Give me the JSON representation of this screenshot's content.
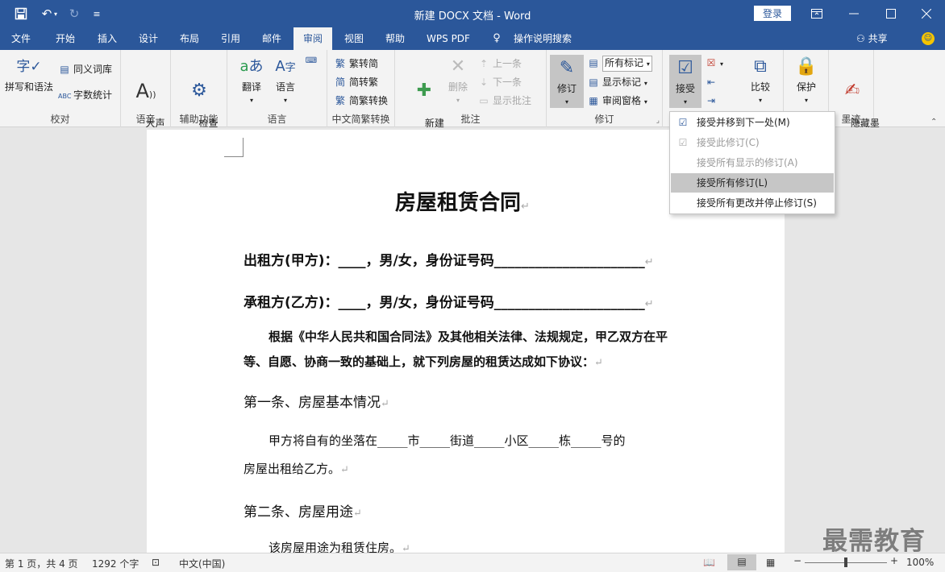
{
  "titlebar": {
    "save_icon": "save-icon",
    "undo_icon": "undo-icon",
    "redo_icon": "redo-icon",
    "customize_icon": "customize-quick-access-icon",
    "title": "新建 DOCX 文档 - Word",
    "login": "登录",
    "restore_icon": "ribbon-display-icon",
    "minimize_icon": "minimize-icon",
    "maximize_icon": "maximize-icon",
    "close_icon": "close-icon"
  },
  "tabs": [
    {
      "label": "文件"
    },
    {
      "label": "开始"
    },
    {
      "label": "插入"
    },
    {
      "label": "设计"
    },
    {
      "label": "布局"
    },
    {
      "label": "引用"
    },
    {
      "label": "邮件"
    },
    {
      "label": "审阅"
    },
    {
      "label": "视图"
    },
    {
      "label": "帮助"
    },
    {
      "label": "WPS PDF"
    },
    {
      "label": "操作说明搜索"
    }
  ],
  "share": "共享",
  "ribbon": {
    "proof": {
      "label": "校对",
      "spell": "拼写和语法",
      "thesaurus": "同义词库",
      "wordcount": "字数统计"
    },
    "speech": {
      "label": "语音",
      "read": "大声\n朗读"
    },
    "access": {
      "label": "辅助功能",
      "check": "检查\n辅助功能"
    },
    "lang": {
      "label": "语言",
      "translate": "翻译",
      "language": "语言"
    },
    "chinese": {
      "label": "中文简繁转换",
      "t2s": "繁转简",
      "s2t": "简转繁",
      "conv": "简繁转换"
    },
    "comments": {
      "label": "批注",
      "new": "新建\n批注",
      "delete": "删除",
      "prev": "上一条",
      "next": "下一条",
      "show": "显示批注"
    },
    "tracking": {
      "label": "修订",
      "track": "修订",
      "markup_select": "所有标记",
      "show_markup": "显示标记",
      "pane": "审阅窗格"
    },
    "changes": {
      "accept": "接受"
    },
    "compare": {
      "label": "比较",
      "compare": "比较"
    },
    "protect": {
      "protect": "保护"
    },
    "ink": {
      "label": "墨迹",
      "hide": "隐藏墨\n迹"
    }
  },
  "menu": [
    {
      "label": "接受并移到下一处(M)",
      "icon": "accept-next-icon",
      "disabled": false
    },
    {
      "label": "接受此修订(C)",
      "icon": "accept-this-icon",
      "disabled": true
    },
    {
      "label": "接受所有显示的修订(A)",
      "icon": "",
      "disabled": true
    },
    {
      "label": "接受所有修订(L)",
      "icon": "",
      "disabled": false,
      "highlighted": true
    },
    {
      "label": "接受所有更改并停止修订(S)",
      "icon": "",
      "disabled": false
    }
  ],
  "document": {
    "title": "房屋租赁合同",
    "lessor": "出租方(甲方)：____，男/女，身份证号码______________________",
    "lessee": "承租方(乙方)：____，男/女，身份证号码______________________",
    "intro1": "根据《中华人民共和国合同法》及其他相关法律、法规规定，甲乙双方在平",
    "intro2": "等、自愿、协商一致的基础上，就下列房屋的租赁达成如下协议：",
    "art1": "第一条、房屋基本情况",
    "art1_p1": "甲方将自有的坐落在_____市_____街道_____小区_____栋_____号的",
    "art1_p2": "房屋出租给乙方。",
    "art2": "第二条、房屋用途",
    "art2_p1": "该房屋用途为租赁住房。",
    "mark": "↵"
  },
  "watermark": "最需教育",
  "status": {
    "page": "第 1 页，共 4 页",
    "words": "1292 个字",
    "lang": "中文(中国)",
    "zoom": "100%",
    "zoom_level": 0.5
  }
}
